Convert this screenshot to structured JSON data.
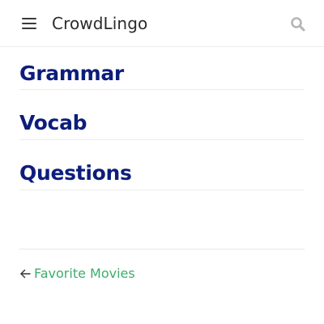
{
  "header": {
    "app_title": "CrowdLingo",
    "menu_icon": "hamburger-menu-icon",
    "search_icon": "search-icon"
  },
  "sections": [
    {
      "label": "Grammar"
    },
    {
      "label": "Vocab"
    },
    {
      "label": "Questions"
    }
  ],
  "footer_nav": {
    "back_label": "Favorite Movies",
    "back_icon": "arrow-left-icon"
  },
  "colors": {
    "section_title": "#0d1d7b",
    "link": "#3cae6c",
    "header_text": "#2b2b2b",
    "icon_gray": "#b5b5b5"
  }
}
